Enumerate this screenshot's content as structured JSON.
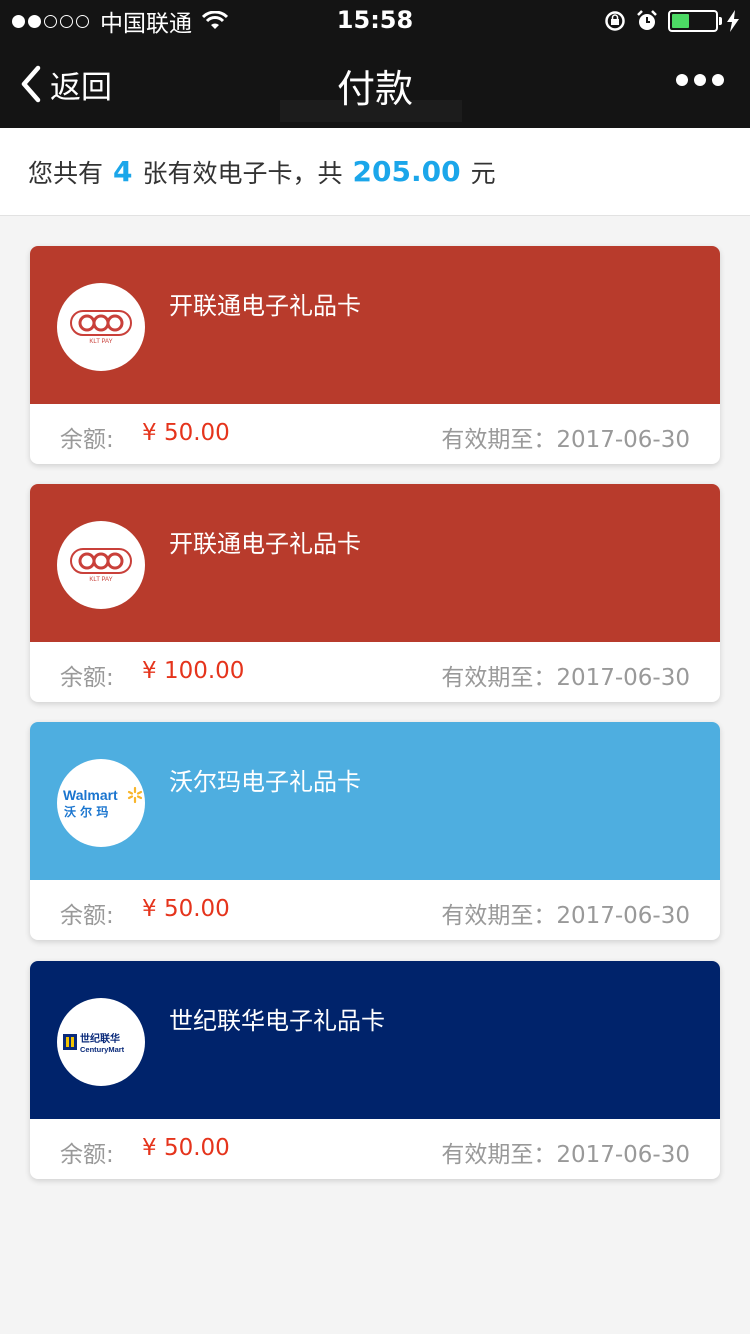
{
  "status_bar": {
    "carrier": "中国联通",
    "time": "15:58",
    "battery_level": 0.4
  },
  "nav": {
    "back_label": "返回",
    "title": "付款"
  },
  "summary": {
    "prefix": "您共有",
    "count": "4",
    "mid": "张有效电子卡，共",
    "total": "205.00",
    "suffix": "元"
  },
  "cards": [
    {
      "name": "开联通电子礼品卡",
      "balance_label": "余额:",
      "balance": "¥ 50.00",
      "expiry": "有效期至：2017-06-30",
      "color": "#b83b2c",
      "logo": "klt-pay-logo",
      "logo_text": "KLT PAY"
    },
    {
      "name": "开联通电子礼品卡",
      "balance_label": "余额:",
      "balance": "¥ 100.00",
      "expiry": "有效期至：2017-06-30",
      "color": "#b83b2c",
      "logo": "klt-pay-logo",
      "logo_text": "KLT PAY"
    },
    {
      "name": "沃尔玛电子礼品卡",
      "balance_label": "余额:",
      "balance": "¥ 50.00",
      "expiry": "有效期至：2017-06-30",
      "color": "#4eaee0",
      "logo": "walmart-logo",
      "logo_text": "Walmart",
      "logo_subtext": "沃 尔 玛"
    },
    {
      "name": "世纪联华电子礼品卡",
      "balance_label": "余额:",
      "balance": "¥ 50.00",
      "expiry": "有效期至：2017-06-30",
      "color": "#00236b",
      "logo": "centurymart-logo",
      "logo_text": "世纪联华",
      "logo_subtext": "CenturyMart"
    }
  ]
}
